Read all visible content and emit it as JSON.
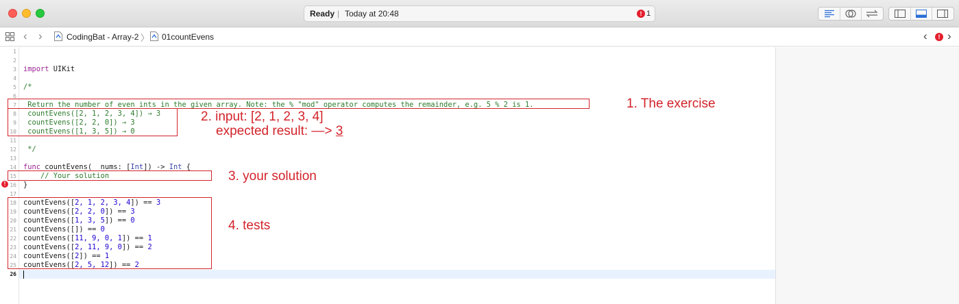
{
  "titlebar": {
    "status_label": "Ready",
    "status_time": "Today at 20:48",
    "error_count": "1",
    "error_glyph": "!"
  },
  "jumpbar": {
    "project": "CodingBat - Array-2",
    "file": "01countEvens",
    "error_glyph": "!"
  },
  "editor": {
    "line_numbers": [
      "1",
      "2",
      "3",
      "4",
      "5",
      "6",
      "7",
      "8",
      "9",
      "10",
      "11",
      "12",
      "13",
      "14",
      "15",
      "16",
      "17",
      "18",
      "19",
      "20",
      "21",
      "22",
      "23",
      "24",
      "25",
      "26"
    ],
    "current_line": "26",
    "lines": {
      "l3_kw": "import",
      "l3_rest": " UIKit",
      "l5": "/*",
      "l7": " Return the number of even ints in the given array. Note: the % \"mod\" operator computes the remainder, e.g. 5 % 2 is 1.",
      "l8": " countEvens([2, 1, 2, 3, 4]) → 3",
      "l9": " countEvens([2, 2, 0]) → 3",
      "l10": " countEvens([1, 3, 5]) → 0",
      "l12": " */",
      "l14_kw": "func",
      "l14_name": " countEvens(",
      "l14_kw2": "_",
      "l14_mid": " nums: [",
      "l14_type": "Int",
      "l14_mid2": "]) -> ",
      "l14_type2": "Int",
      "l14_end": " {",
      "l15": "    // Your solution",
      "l16": "}"
    },
    "tests": [
      {
        "pre": "countEvens([",
        "nums": "2, 1, 2, 3, 4",
        "mid": "]) == ",
        "res": "3"
      },
      {
        "pre": "countEvens([",
        "nums": "2, 2, 0",
        "mid": "]) == ",
        "res": "3"
      },
      {
        "pre": "countEvens([",
        "nums": "1, 3, 5",
        "mid": "]) == ",
        "res": "0"
      },
      {
        "pre": "countEvens([",
        "nums": "",
        "mid": "]) == ",
        "res": "0"
      },
      {
        "pre": "countEvens([",
        "nums": "11, 9, 0, 1",
        "mid": "]) == ",
        "res": "1"
      },
      {
        "pre": "countEvens([",
        "nums": "2, 11, 9, 0",
        "mid": "]) == ",
        "res": "2"
      },
      {
        "pre": "countEvens([",
        "nums": "2",
        "mid": "]) == ",
        "res": "1"
      },
      {
        "pre": "countEvens([",
        "nums": "2, 5, 12",
        "mid": "]) == ",
        "res": "2"
      }
    ]
  },
  "annotations": {
    "exercise": "1. The exercise",
    "input": "2. input: [2, 1, 2, 3, 4]",
    "expected_prefix": "expected result: —> ",
    "expected_value": "3",
    "solution": "3. your solution",
    "tests": "4. tests"
  },
  "colors": {
    "comment": "#2b7a2b",
    "keyword": "#9b2393",
    "type": "#3a45a8",
    "number": "#1c00cf",
    "annotation": "#d2232a",
    "error": "#e4202e"
  }
}
